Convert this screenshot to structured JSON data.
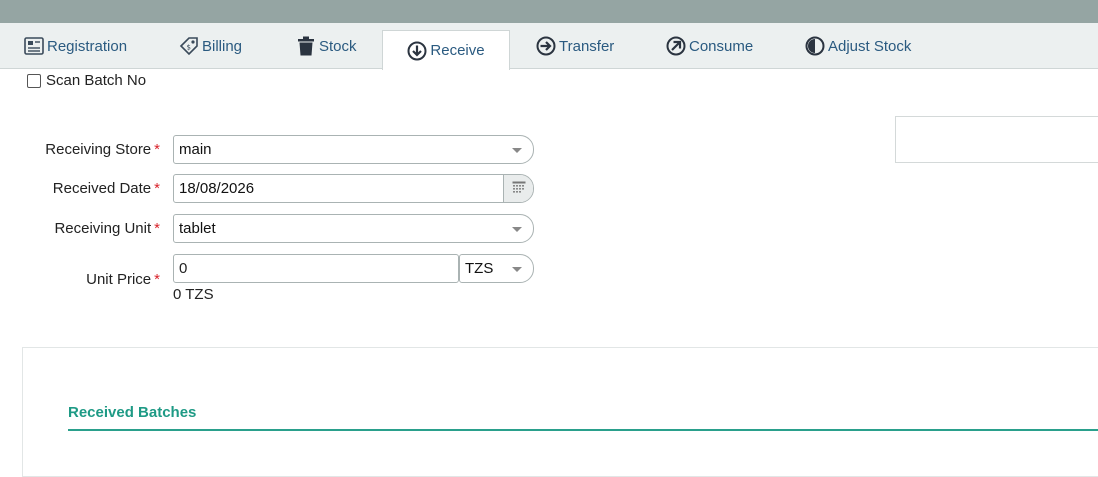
{
  "tabs": [
    {
      "label": "Registration",
      "icon": "registration-card-icon"
    },
    {
      "label": "Billing",
      "icon": "price-tag-icon"
    },
    {
      "label": "Stock",
      "icon": "trash-bin-icon"
    },
    {
      "label": "Receive",
      "icon": "arrow-down-circle-icon",
      "active": true
    },
    {
      "label": "Transfer",
      "icon": "arrow-right-circle-icon"
    },
    {
      "label": "Consume",
      "icon": "arrow-up-right-circle-icon"
    },
    {
      "label": "Adjust Stock",
      "icon": "half-circle-icon"
    }
  ],
  "scan": {
    "label": "Scan Batch No",
    "checked": false
  },
  "form": {
    "receiving_store": {
      "label": "Receiving Store",
      "value": "main"
    },
    "received_date": {
      "label": "Received Date",
      "value": "18/08/2026"
    },
    "receiving_unit": {
      "label": "Receiving Unit",
      "value": "tablet"
    },
    "unit_price": {
      "label": "Unit Price",
      "value": "0",
      "currency": "TZS",
      "total": "0 TZS"
    },
    "required_mark": "*"
  },
  "batches": {
    "title": "Received Batches"
  },
  "colors": {
    "accent": "#1e9a85",
    "link": "#2a5a80",
    "required": "#d9222a",
    "topbar": "#95a5a3"
  }
}
